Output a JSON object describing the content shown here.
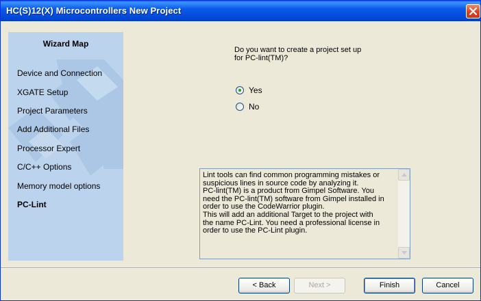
{
  "window": {
    "title": "HC(S)12(X) Microcontrollers New Project"
  },
  "sidebar": {
    "title": "Wizard Map",
    "items": [
      {
        "label": "Device and Connection",
        "active": false
      },
      {
        "label": "XGATE Setup",
        "active": false
      },
      {
        "label": "Project Parameters",
        "active": false
      },
      {
        "label": "Add Additional Files",
        "active": false
      },
      {
        "label": "Processor Expert",
        "active": false
      },
      {
        "label": "C/C++ Options",
        "active": false
      },
      {
        "label": "Memory model options",
        "active": false
      },
      {
        "label": "PC-Lint",
        "active": true
      }
    ]
  },
  "main": {
    "question_lines": [
      "Do you want to create a project set up",
      "for PC-lint(TM)?"
    ],
    "options": [
      {
        "label": "Yes",
        "selected": true
      },
      {
        "label": "No",
        "selected": false
      }
    ],
    "info_lines": [
      "Lint tools can find common programming mistakes or",
      "suspicious lines in source code by analyzing it.",
      "PC-lint(TM) is a product from Gimpel Software. You",
      "need the PC-lint(TM) software from Gimpel installed in",
      "order to use the CodeWarrior plugin.",
      "This will add an additional Target to the project with",
      "the name PC-Lint. You need a professional license in",
      "order to use the PC-Lint plugin."
    ]
  },
  "buttons": {
    "back": "< Back",
    "next": "Next >",
    "finish": "Finish",
    "cancel": "Cancel"
  },
  "icons": {
    "close": "close-icon",
    "scroll_up": "scroll-up-arrow-icon",
    "scroll_down": "scroll-down-arrow-icon"
  },
  "colors": {
    "titlebar": "#0a59e8",
    "sidebar": "#bbd3ec",
    "dialog_bg": "#ece9d8",
    "close_button": "#d6432a"
  }
}
